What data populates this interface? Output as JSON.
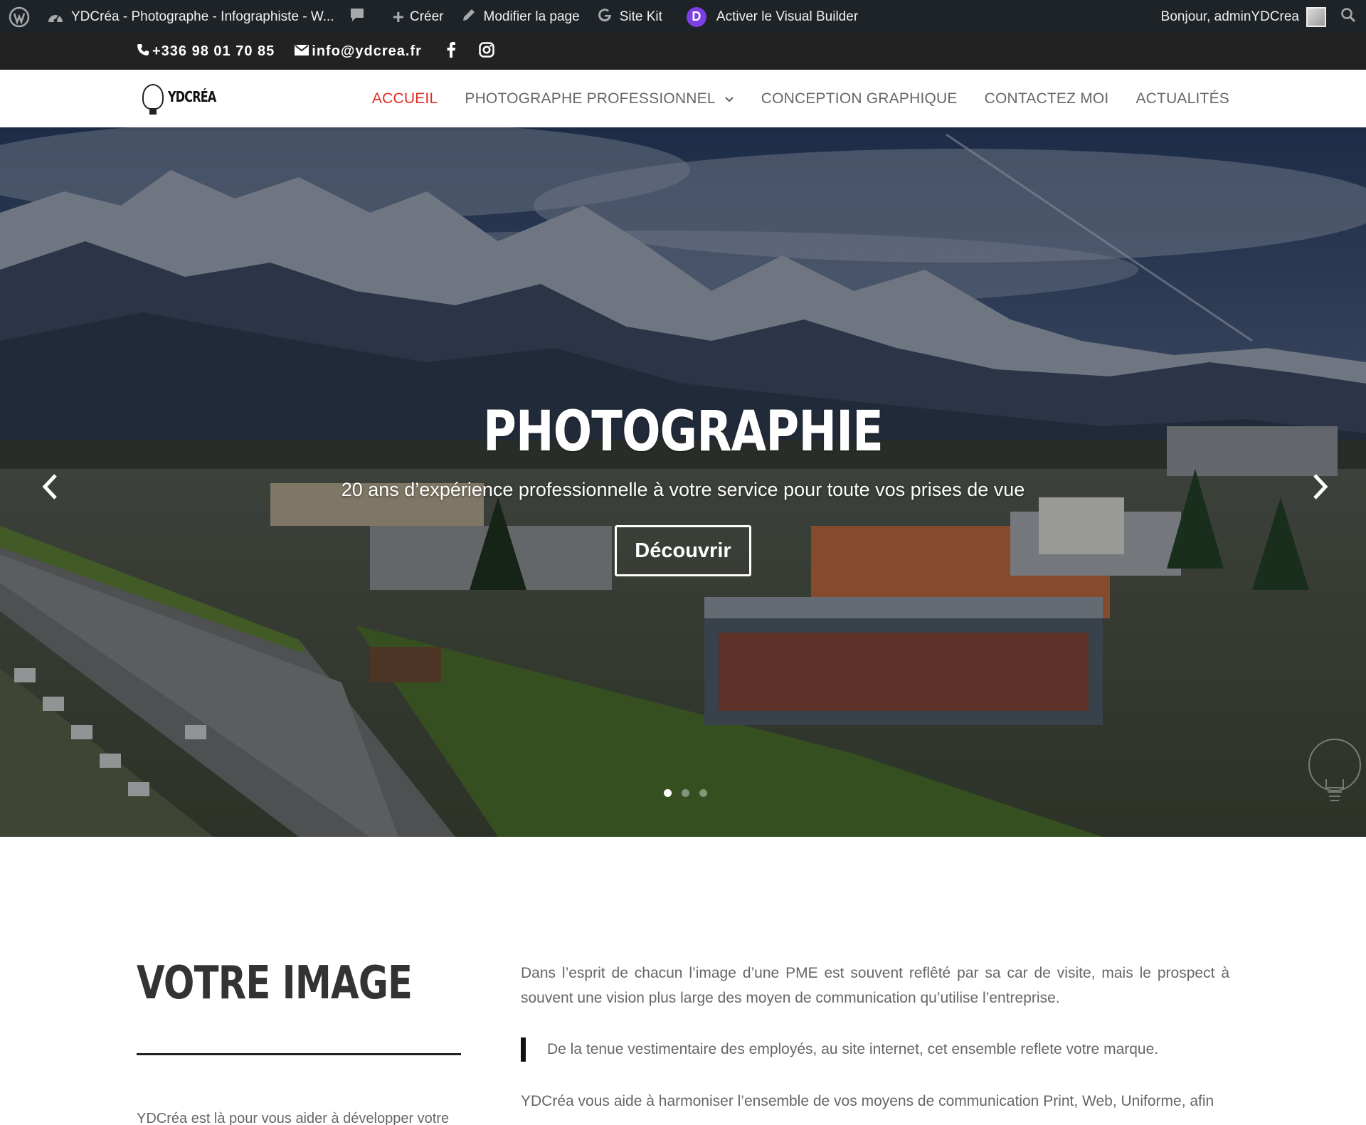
{
  "adminbar": {
    "site_name": "YDCréa - Photographe - Infographiste - W...",
    "create_label": "Créer",
    "edit_label": "Modifier la page",
    "sitekit_label": "Site Kit",
    "divi_letter": "D",
    "visual_builder_label": "Activer le Visual Builder",
    "greeting": "Bonjour, adminYDCrea"
  },
  "topbar": {
    "phone": "+336 98 01 70 85",
    "email": "info@ydcrea.fr"
  },
  "header": {
    "logo_text": "YDCRÉA",
    "nav": [
      {
        "label": "Accueil"
      },
      {
        "label": "Photographe professionnel"
      },
      {
        "label": "Conception graphique"
      },
      {
        "label": "Contactez moi"
      },
      {
        "label": "Actualités"
      }
    ]
  },
  "hero": {
    "title": "PHOTOGRAPHIE",
    "subtitle": "20 ans d’expérience professionnelle à votre service pour toute vos prises de vue",
    "button_label": "Découvrir",
    "slide_count": 3,
    "active_slide": 1
  },
  "content": {
    "title": "VOTRE IMAGE",
    "left_text": "YDCréa est là pour vous aider à développer votre",
    "para1": "Dans l’esprit de chacun l’image d’une PME est souvent reflêté par sa car de visite, mais le prospect à souvent une vision plus large des moyen de communication qu’utilise l’entreprise.",
    "quote": "De la tenue vestimentaire des employés, au site internet, cet ensemble reflete votre marque.",
    "para2": "YDCréa vous aide à harmoniser l’ensemble de vos moyens de communication Print, Web, Uniforme, afin"
  },
  "colors": {
    "accent": "#e02b20",
    "admin_bar": "#1d2327",
    "top_bar": "#222222",
    "divi": "#7b3fe4"
  }
}
